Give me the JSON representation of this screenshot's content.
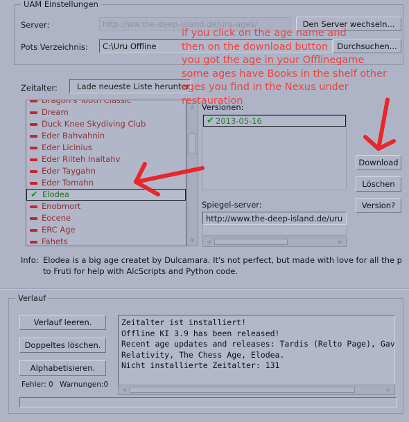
{
  "settings_group": {
    "legend": "UAM Einstellungen",
    "server_label": "Server:",
    "server_value": "http://ww.the-deep-island.de/uru-ages/",
    "server_button": "Den Server wechseln...",
    "path_label": "Pots Verzeichnis:",
    "path_value": "C:\\Uru Offline",
    "path_button": "Durchsuchen..."
  },
  "ages": {
    "label": "Zeitalter:",
    "refresh_button": "Lade neueste Liste herunter",
    "items": [
      {
        "name": "Dragon's Tooth Classic",
        "installed": false
      },
      {
        "name": "Dream",
        "installed": false
      },
      {
        "name": "Duck Knee Skydiving Club",
        "installed": false
      },
      {
        "name": "Eder Bahvahnin",
        "installed": false
      },
      {
        "name": "Eder Licinius",
        "installed": false
      },
      {
        "name": "Eder Rilteh Inaltahv",
        "installed": false
      },
      {
        "name": "Eder Taygahn",
        "installed": false
      },
      {
        "name": "Eder Tomahn",
        "installed": false
      },
      {
        "name": "Elodea",
        "installed": true,
        "selected": true
      },
      {
        "name": "Enobmort",
        "installed": false
      },
      {
        "name": "Eocene",
        "installed": false
      },
      {
        "name": "ERC Age",
        "installed": false
      },
      {
        "name": "Fahets",
        "installed": false
      }
    ]
  },
  "versions": {
    "label": "Versionen:",
    "items": [
      {
        "date": "2013-05-16",
        "installed": true,
        "selected": true
      }
    ]
  },
  "mirror": {
    "label": "Spiegel-server:",
    "value": "http://www.the-deep-island.de/uru"
  },
  "actions": {
    "download": "Download",
    "delete": "Löschen",
    "version": "Version?"
  },
  "info": {
    "prefix": "Info:",
    "line1": "Elodea is a big age createt by Dulcamara. It's not perfect, but made with love for all the p",
    "line2": "to Fruti for help with AlcScripts and Python code."
  },
  "history": {
    "legend": "Verlauf",
    "clear_button": "Verlauf leeren.",
    "dedupe_button": "Doppeltes löschen.",
    "sort_button": "Alphabetisieren.",
    "errors_label": "Fehler: 0",
    "warnings_label": "Warnungen:0",
    "log_lines": [
      "Zeitalter ist installiert!",
      "Offline KI 3.9 has been released!",
      "Recent age updates and releases: Tardis (Relto Page), Gavst",
      "Relativity, The Chess Age, Elodea.",
      "Nicht installierte Zeitalter: 131"
    ]
  },
  "annotation": {
    "color": "#f04040",
    "lines": [
      "if you click on the age name and",
      "then on the download button",
      "you got the age in your Offlinegame",
      "some ages have Books in the shelf other",
      "ages you find in the Nexus under",
      "restauration"
    ]
  },
  "colors": {
    "background": "#aeb4c6",
    "installed": "#1d6a1d",
    "not_installed": "#8e3034",
    "annotation": "#f04040"
  }
}
